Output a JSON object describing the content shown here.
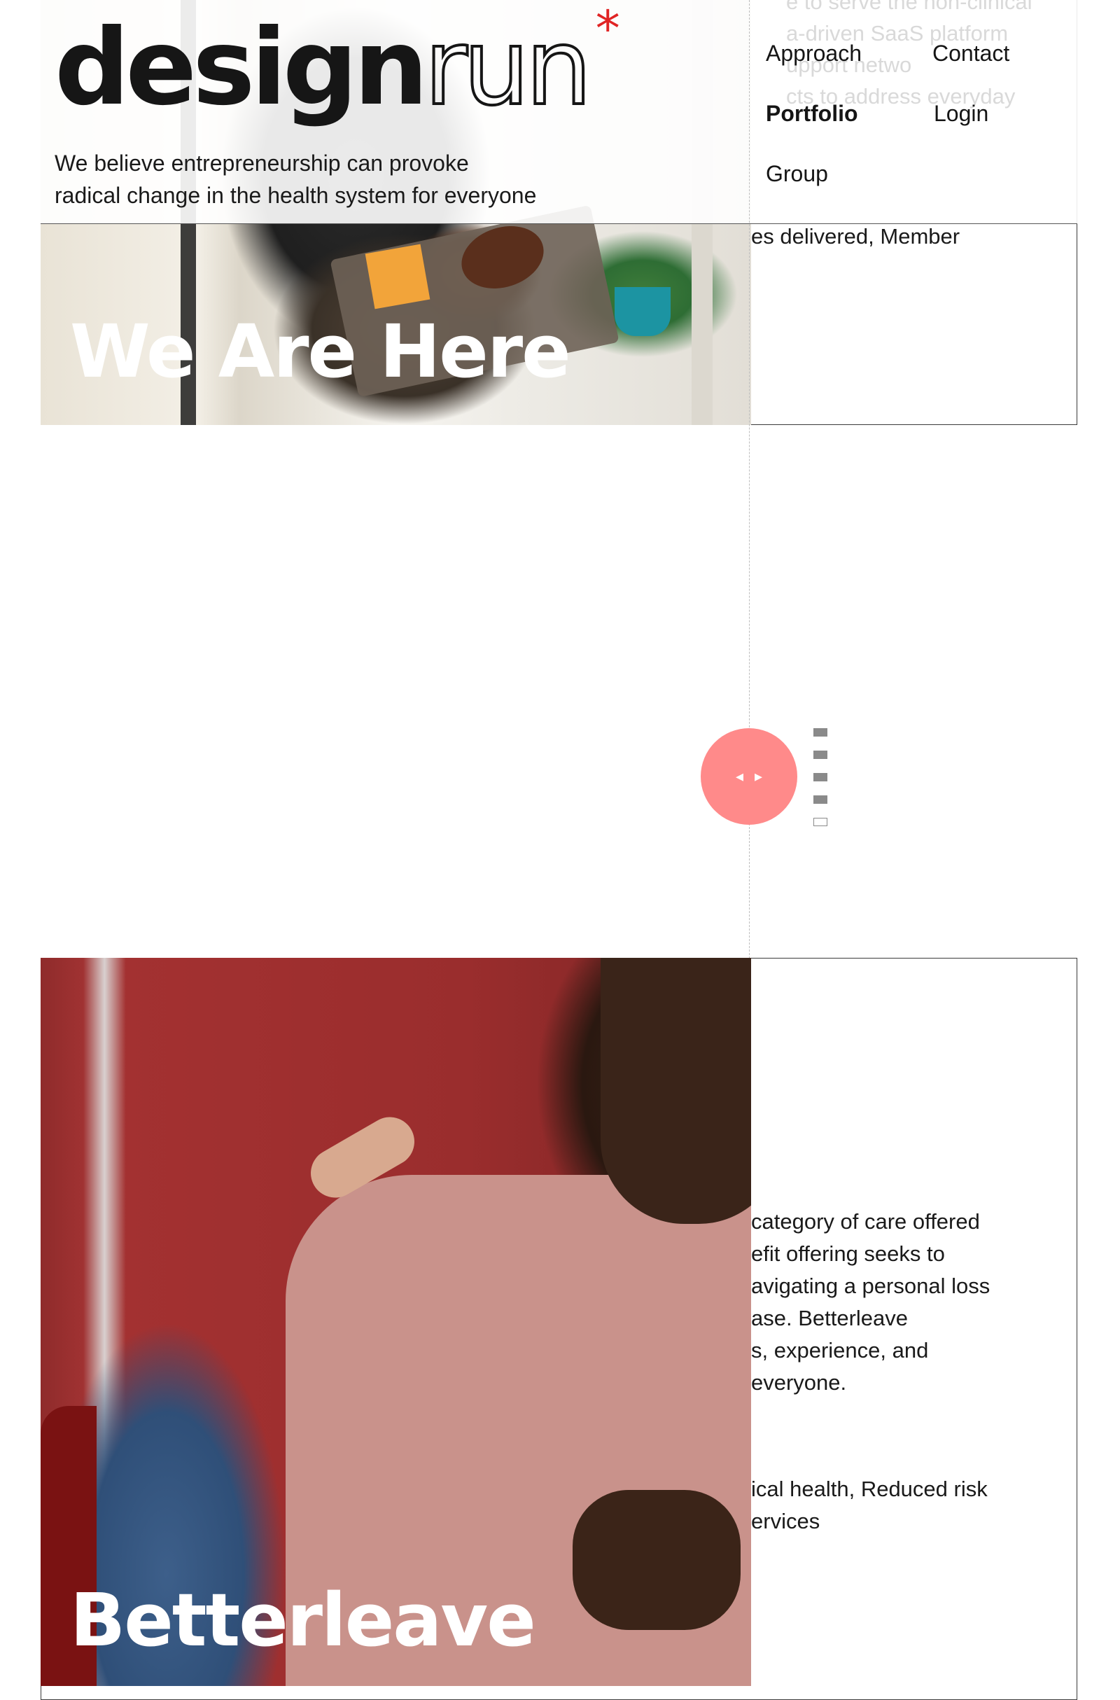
{
  "brand": {
    "logo_bold": "design",
    "logo_light": "run",
    "logo_star": "*",
    "tagline_line1": "We believe entrepreneurship can provoke",
    "tagline_line2": "radical change in the health system for everyone"
  },
  "nav": {
    "items": [
      {
        "label": "Approach",
        "active": false
      },
      {
        "label": "Contact",
        "active": false
      },
      {
        "label": "Portfolio",
        "active": true
      },
      {
        "label": "Login",
        "active": false
      },
      {
        "label": "Group",
        "active": false
      }
    ]
  },
  "background_text": {
    "line1": "e to serve the non-clinical",
    "line2": "a-driven SaaS platform",
    "line3": "upport netwo",
    "line4": "cts to address everyday"
  },
  "cards": [
    {
      "title": "We Are Here",
      "side_text": "es delivered, Member"
    },
    {
      "title": "Betterleave",
      "paragraph_lines": [
        "category of care offered",
        "efit offering seeks to",
        "avigating a personal loss",
        "ase. Betterleave",
        "s, experience, and",
        " everyone."
      ],
      "outcome_lines": [
        "ical health, Reduced risk",
        "ervices"
      ]
    }
  ],
  "slider": {
    "prev_glyph": "◂",
    "next_glyph": "▸",
    "accent": "#ff8a8a",
    "total_slides": 5,
    "active_slide": 5
  }
}
